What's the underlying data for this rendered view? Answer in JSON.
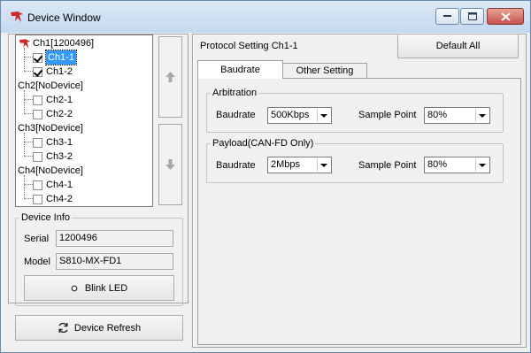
{
  "window": {
    "title": "Device Window"
  },
  "tree": [
    {
      "label": "Ch1[1200496]",
      "type": "device"
    },
    {
      "label": "Ch1-1",
      "type": "channel",
      "checked": true,
      "selected": true
    },
    {
      "label": "Ch1-2",
      "type": "channel",
      "checked": true,
      "selected": false
    },
    {
      "label": "Ch2[NoDevice]",
      "type": "device"
    },
    {
      "label": "Ch2-1",
      "type": "channel",
      "checked": false
    },
    {
      "label": "Ch2-2",
      "type": "channel",
      "checked": false
    },
    {
      "label": "Ch3[NoDevice]",
      "type": "device"
    },
    {
      "label": "Ch3-1",
      "type": "channel",
      "checked": false
    },
    {
      "label": "Ch3-2",
      "type": "channel",
      "checked": false
    },
    {
      "label": "Ch4[NoDevice]",
      "type": "device"
    },
    {
      "label": "Ch4-1",
      "type": "channel",
      "checked": false
    },
    {
      "label": "Ch4-2",
      "type": "channel",
      "checked": false
    }
  ],
  "device_info": {
    "legend": "Device Info",
    "serial_label": "Serial",
    "serial_value": "1200496",
    "model_label": "Model",
    "model_value": "S810-MX-FD1",
    "blink_label": "Blink LED"
  },
  "refresh_label": "Device Refresh",
  "protocol": {
    "heading": "Protocol Setting Ch1-1",
    "default_all": "Default All",
    "tabs": [
      "Baudrate",
      "Other Setting"
    ],
    "arbitration": {
      "legend": "Arbitration",
      "baudrate_label": "Baudrate",
      "baudrate_value": "500Kbps",
      "sample_label": "Sample Point",
      "sample_value": "80%"
    },
    "payload": {
      "legend": "Payload(CAN-FD Only)",
      "baudrate_label": "Baudrate",
      "baudrate_value": "2Mbps",
      "sample_label": "Sample Point",
      "sample_value": "80%"
    }
  },
  "colors": {
    "selection": "#3399ff",
    "brand_icon": "#cc2a2a"
  }
}
